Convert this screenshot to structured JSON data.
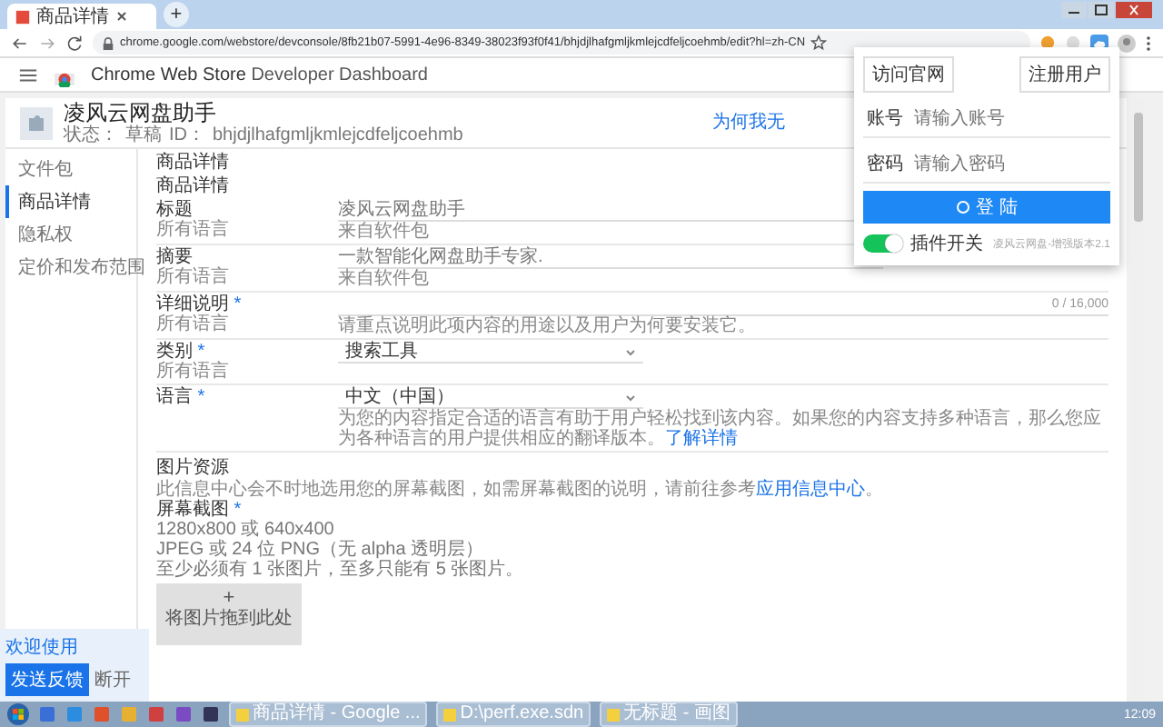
{
  "browser": {
    "tabs": [
      {
        "title": "商品详情",
        "selected": true
      }
    ],
    "new_tab": "+",
    "url": "chrome.google.com/webstore/devconsole/8fb21b07-5991-4e96-8349-38023f93f0f41/bhjdjlhafgmljkmlejcdfeljcoehmb/edit?hl=zh-CN"
  },
  "app": {
    "title_bold": "Chrome Web Store",
    "title_rest": "Developer Dashboard"
  },
  "item": {
    "name": "凌风云网盘助手",
    "status_label": "状态：",
    "status": "草稿",
    "id_label": "ID：",
    "id": "bhjdjlhafgmljkmlejcdfeljcoehmb",
    "link": "为何我无"
  },
  "sidebar": [
    {
      "label": "文件包",
      "selected": false
    },
    {
      "label": "商品详情",
      "selected": true
    },
    {
      "label": "隐私权",
      "selected": false
    },
    {
      "label": "定价和发布范围",
      "selected": false
    }
  ],
  "page_heading": "商品详情",
  "section_heading": "商品详情",
  "fields": [
    {
      "kind": "text",
      "label": "标题",
      "sublabel": "所有语言",
      "value": "凌风云网盘助手",
      "helper": "来自软件包"
    },
    {
      "kind": "text",
      "label": "摘要",
      "sublabel": "所有语言",
      "value": "一款智能化网盘助手专家.",
      "helper": "来自软件包"
    },
    {
      "kind": "textarea",
      "label": "详细说明",
      "mark": "*",
      "sublabel": "所有语言",
      "counter": "0 / 16,000",
      "helper": "请重点说明此项内容的用途以及用户为何要安装它。"
    },
    {
      "kind": "select",
      "label": "类别",
      "mark": "*",
      "sublabel": "所有语言",
      "value": "搜索工具"
    },
    {
      "kind": "select",
      "label": "语言",
      "mark": "*",
      "value": "中文（中国）",
      "helper": "为您的内容指定合适的语言有助于用户轻松找到该内容。如果您的内容支持多种语言，那么您应为各种语言的用户提供相应的翻译版本。",
      "link": "了解详情"
    }
  ],
  "images": {
    "heading": "图片资源",
    "description": "此信息中心会不时地选用您的屏幕截图，如需屏幕截图的说明，请前往参考",
    "description_link": "应用信息中心",
    "description_end": "。",
    "label": "屏幕截图",
    "mark": "*",
    "lines": [
      "1280x800 或 640x400",
      "JPEG 或 24 位 PNG（无 alpha 透明层）",
      "至少必须有 1 张图片，至多只能有 5 张图片。"
    ],
    "drop_icon": "+",
    "drop_label": "将图片拖到此处"
  },
  "popup": {
    "buttons": [
      "访问官网",
      "注册用户"
    ],
    "fields": [
      {
        "label": "账号",
        "placeholder": "请输入账号"
      },
      {
        "label": "密码",
        "placeholder": "请输入密码"
      }
    ],
    "login": "登 陆",
    "switch": {
      "on": true,
      "label": "插件开关"
    },
    "version": "凌风云网盘-增强版本2.1"
  },
  "feedback": {
    "welcome": "欢迎使用",
    "button": "发送反馈",
    "close": "断开"
  },
  "taskbar": {
    "tasks": [
      "商品详情 - Google ...",
      "D:\\perf.exe.sdn",
      "无标题 - 画图"
    ],
    "clock": "12:09"
  }
}
